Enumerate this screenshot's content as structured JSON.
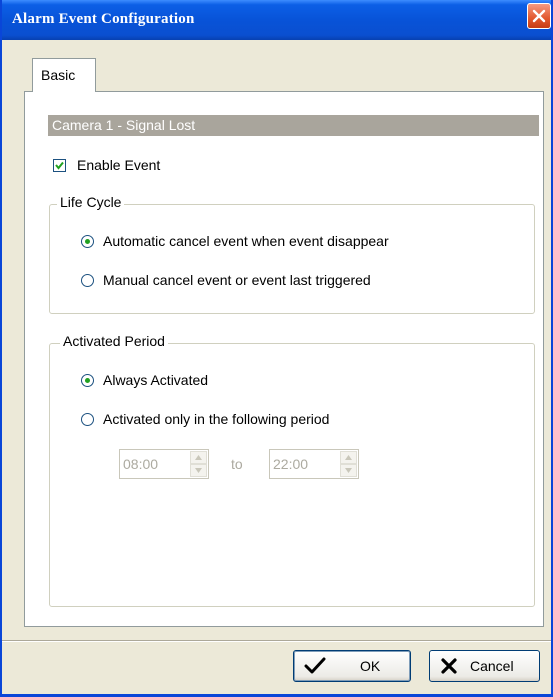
{
  "window": {
    "title": "Alarm Event Configuration",
    "close_icon": "close-icon"
  },
  "tabs": [
    {
      "label": "Basic",
      "selected": true
    }
  ],
  "event": {
    "header": "Camera 1 - Signal Lost",
    "enable_label": "Enable Event",
    "enable_checked": true
  },
  "life_cycle": {
    "title": "Life Cycle",
    "options": [
      {
        "label": "Automatic cancel event when event disappear",
        "selected": true
      },
      {
        "label": "Manual cancel event or event last triggered",
        "selected": false
      }
    ]
  },
  "activated_period": {
    "title": "Activated Period",
    "options": [
      {
        "label": "Always Activated",
        "selected": true
      },
      {
        "label": "Activated only in the following period",
        "selected": false
      }
    ],
    "from_time": "08:00",
    "to_label": "to",
    "to_time": "22:00",
    "enabled": false
  },
  "buttons": {
    "ok_label": "OK",
    "ok_icon": "checkmark-icon",
    "cancel_label": "Cancel",
    "cancel_icon": "x-icon"
  },
  "colors": {
    "titlebar": "#0853d8",
    "dialog_bg": "#ece9d8",
    "header_bar": "#a9a59c",
    "radio_dot": "#21a121",
    "disabled_text": "#acaaa0"
  }
}
